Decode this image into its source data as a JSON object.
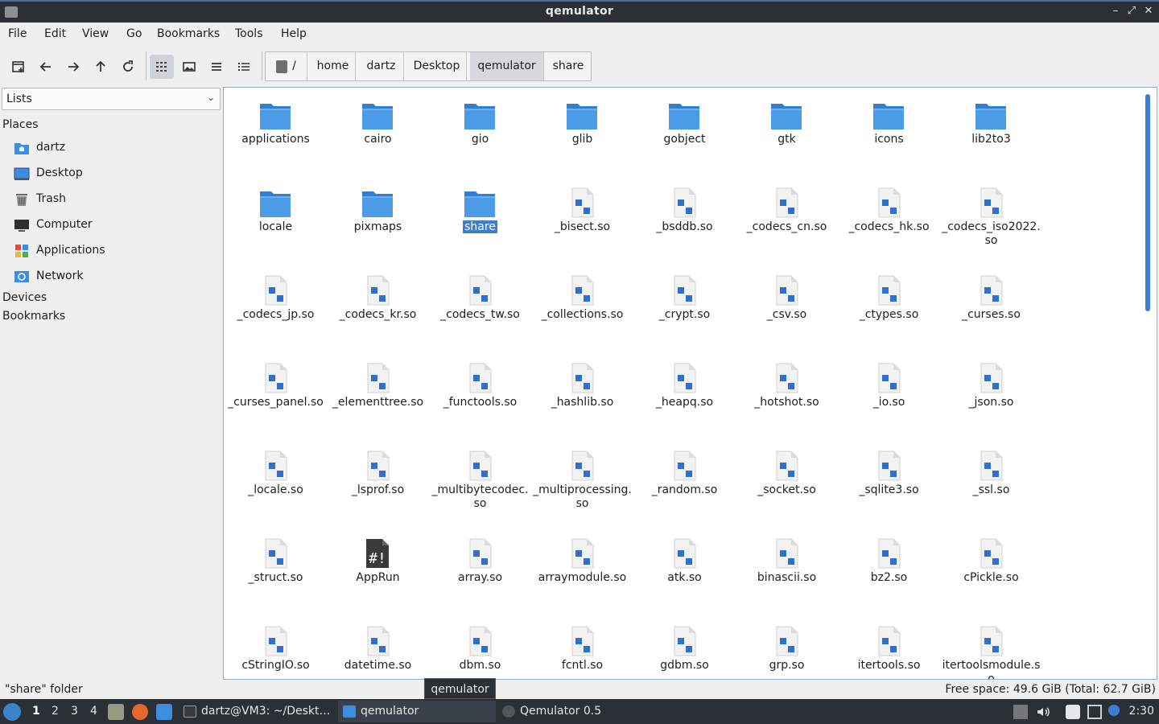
{
  "window": {
    "title": "qemulator"
  },
  "menu": [
    "File",
    "Edit",
    "View",
    "Go",
    "Bookmarks",
    "Tools",
    "Help"
  ],
  "breadcrumb": {
    "root": "/",
    "parts": [
      "home",
      "dartz",
      "Desktop",
      "qemulator",
      "share"
    ],
    "active": "qemulator"
  },
  "sidebar": {
    "combo": "Lists",
    "places_header": "Places",
    "places": [
      {
        "label": "dartz",
        "icon": "home-folder-icon"
      },
      {
        "label": "Desktop",
        "icon": "desktop-icon"
      },
      {
        "label": "Trash",
        "icon": "trash-icon"
      },
      {
        "label": "Computer",
        "icon": "computer-icon"
      },
      {
        "label": "Applications",
        "icon": "applications-icon"
      },
      {
        "label": "Network",
        "icon": "network-icon"
      }
    ],
    "devices_header": "Devices",
    "bookmarks_header": "Bookmarks"
  },
  "files": [
    {
      "name": "applications",
      "type": "folder"
    },
    {
      "name": "cairo",
      "type": "folder"
    },
    {
      "name": "gio",
      "type": "folder"
    },
    {
      "name": "glib",
      "type": "folder"
    },
    {
      "name": "gobject",
      "type": "folder"
    },
    {
      "name": "gtk",
      "type": "folder"
    },
    {
      "name": "icons",
      "type": "folder"
    },
    {
      "name": "lib2to3",
      "type": "folder"
    },
    {
      "name": "locale",
      "type": "folder"
    },
    {
      "name": "pixmaps",
      "type": "folder"
    },
    {
      "name": "share",
      "type": "folder",
      "selected": true
    },
    {
      "name": "_bisect.so",
      "type": "lib"
    },
    {
      "name": "_bsddb.so",
      "type": "lib"
    },
    {
      "name": "_codecs_cn.so",
      "type": "lib"
    },
    {
      "name": "_codecs_hk.so",
      "type": "lib"
    },
    {
      "name": "_codecs_iso2022.so",
      "type": "lib"
    },
    {
      "name": "_codecs_jp.so",
      "type": "lib"
    },
    {
      "name": "_codecs_kr.so",
      "type": "lib"
    },
    {
      "name": "_codecs_tw.so",
      "type": "lib"
    },
    {
      "name": "_collections.so",
      "type": "lib"
    },
    {
      "name": "_crypt.so",
      "type": "lib"
    },
    {
      "name": "_csv.so",
      "type": "lib"
    },
    {
      "name": "_ctypes.so",
      "type": "lib"
    },
    {
      "name": "_curses.so",
      "type": "lib"
    },
    {
      "name": "_curses_panel.so",
      "type": "lib"
    },
    {
      "name": "_elementtree.so",
      "type": "lib"
    },
    {
      "name": "_functools.so",
      "type": "lib"
    },
    {
      "name": "_hashlib.so",
      "type": "lib"
    },
    {
      "name": "_heapq.so",
      "type": "lib"
    },
    {
      "name": "_hotshot.so",
      "type": "lib"
    },
    {
      "name": "_io.so",
      "type": "lib"
    },
    {
      "name": "_json.so",
      "type": "lib"
    },
    {
      "name": "_locale.so",
      "type": "lib"
    },
    {
      "name": "_lsprof.so",
      "type": "lib"
    },
    {
      "name": "_multibytecodec.so",
      "type": "lib"
    },
    {
      "name": "_multiprocessing.so",
      "type": "lib"
    },
    {
      "name": "_random.so",
      "type": "lib"
    },
    {
      "name": "_socket.so",
      "type": "lib"
    },
    {
      "name": "_sqlite3.so",
      "type": "lib"
    },
    {
      "name": "_ssl.so",
      "type": "lib"
    },
    {
      "name": "_struct.so",
      "type": "lib"
    },
    {
      "name": "AppRun",
      "type": "script"
    },
    {
      "name": "array.so",
      "type": "lib"
    },
    {
      "name": "arraymodule.so",
      "type": "lib"
    },
    {
      "name": "atk.so",
      "type": "lib"
    },
    {
      "name": "binascii.so",
      "type": "lib"
    },
    {
      "name": "bz2.so",
      "type": "lib"
    },
    {
      "name": "cPickle.so",
      "type": "lib"
    },
    {
      "name": "cStringIO.so",
      "type": "lib"
    },
    {
      "name": "datetime.so",
      "type": "lib"
    },
    {
      "name": "dbm.so",
      "type": "lib"
    },
    {
      "name": "fcntl.so",
      "type": "lib"
    },
    {
      "name": "gdbm.so",
      "type": "lib"
    },
    {
      "name": "grp.so",
      "type": "lib"
    },
    {
      "name": "itertools.so",
      "type": "lib"
    },
    {
      "name": "itertoolsmodule.so",
      "type": "lib"
    }
  ],
  "status": {
    "selection": "\"share\" folder",
    "free_space": "Free space: 49.6 GiB (Total: 62.7 GiB)"
  },
  "tooltip": "qemulator",
  "taskbar": {
    "workspaces": [
      "1",
      "2",
      "3",
      "4"
    ],
    "tasks": [
      {
        "label": "dartz@VM3: ~/Deskt…",
        "icon": "terminal-icon"
      },
      {
        "label": "qemulator",
        "icon": "folder-window-icon",
        "active": true
      },
      {
        "label": "Qemulator 0.5",
        "icon": "qemulator-app-icon"
      }
    ],
    "clock": "2:30"
  },
  "colors": {
    "accent": "#3c7fd1",
    "folder": "#3d8ee0",
    "panel_dark": "#2b2f36"
  }
}
